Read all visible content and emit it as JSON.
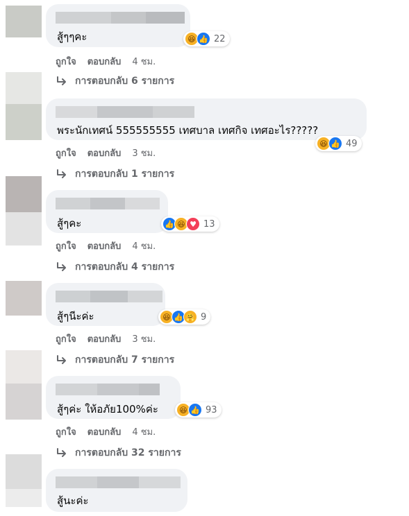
{
  "comments": [
    {
      "text": "สู้ๆๆคะ",
      "reactions": [
        "haha",
        "like"
      ],
      "reaction_count": "22",
      "like_label": "ถูกใจ",
      "reply_label": "ตอบกลับ",
      "time": "4 ชม.",
      "replies_label": "การตอบกลับ 6 รายการ"
    },
    {
      "text": "พระนักเทศน์ 555555555 เทศบาล เทศกิจ เทศอะไร?????",
      "reactions": [
        "haha",
        "like"
      ],
      "reaction_count": "49",
      "like_label": "ถูกใจ",
      "reply_label": "ตอบกลับ",
      "time": "3 ชม.",
      "replies_label": "การตอบกลับ 1 รายการ"
    },
    {
      "text": "สู้ๆคะ",
      "reactions": [
        "like",
        "haha",
        "love"
      ],
      "reaction_count": "13",
      "like_label": "ถูกใจ",
      "reply_label": "ตอบกลับ",
      "time": "4 ชม.",
      "replies_label": "การตอบกลับ 4 รายการ"
    },
    {
      "text": "สู้ๆนีะค่ะ",
      "reactions": [
        "haha",
        "like",
        "care"
      ],
      "reaction_count": "9",
      "like_label": "ถูกใจ",
      "reply_label": "ตอบกลับ",
      "time": "3 ชม.",
      "replies_label": "การตอบกลับ 7 รายการ"
    },
    {
      "text": "สู้ๆค่ะ ให้อภัย100%ค่ะ",
      "reactions": [
        "haha",
        "like"
      ],
      "reaction_count": "93",
      "like_label": "ถูกใจ",
      "reply_label": "ตอบกลับ",
      "time": "4 ชม.",
      "replies_label": "การตอบกลับ 32 รายการ"
    },
    {
      "text": "สู้นะค่ะ"
    }
  ],
  "colors": {
    "bubble_bg": "#f0f2f5",
    "meta_text": "#65676b",
    "like_blue": "#1877f2",
    "haha_yellow": "#f7b125",
    "love_red": "#f33e58"
  }
}
